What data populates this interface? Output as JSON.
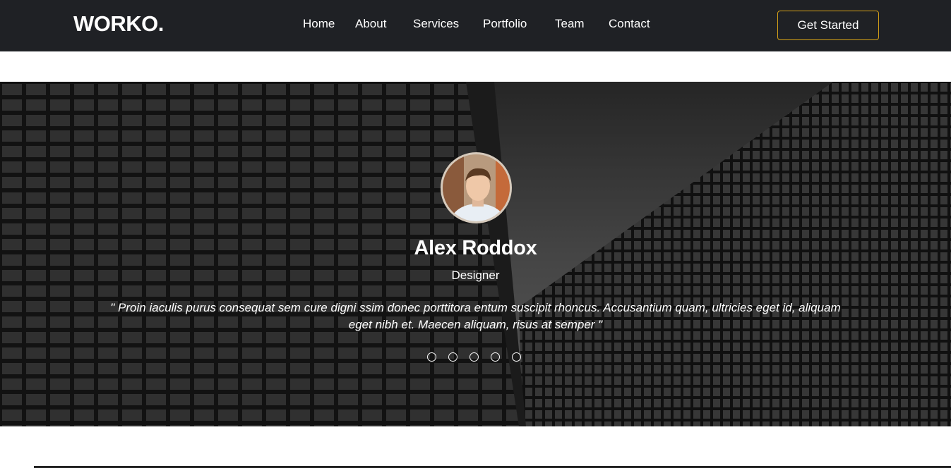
{
  "header": {
    "logo": "WORKO.",
    "nav": [
      "Home",
      "About",
      "Services",
      "Portfolio",
      "Team",
      "Contact"
    ],
    "cta_label": "Get Started",
    "accent_color": "#d4a017",
    "background": "#1f2125"
  },
  "testimonial": {
    "name": "Alex Roddox",
    "role": "Designer",
    "quote": "\" Proin iaculis purus consequat sem cure digni ssim donec porttitora entum suscipit rhoncus. Accusantium quam, ultricies eget id, aliquam eget nibh et. Maecen aliquam, risus at semper \"",
    "slides": 5
  }
}
